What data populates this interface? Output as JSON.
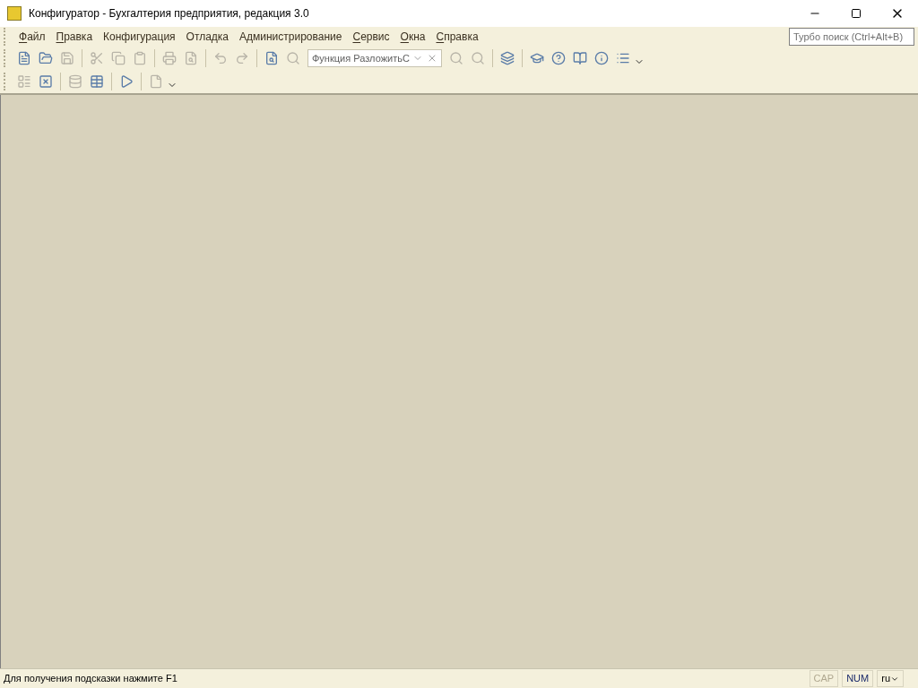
{
  "window": {
    "title": "Конфигуратор - Бухгалтерия предприятия, редакция 3.0"
  },
  "menu": [
    {
      "label": "Файл",
      "accel": true
    },
    {
      "label": "Правка",
      "accel": true
    },
    {
      "label": "Конфигурация",
      "accel": false
    },
    {
      "label": "Отладка",
      "accel": false
    },
    {
      "label": "Администрирование",
      "accel": false
    },
    {
      "label": "Сервис",
      "accel": true
    },
    {
      "label": "Окна",
      "accel": true
    },
    {
      "label": "Справка",
      "accel": true
    }
  ],
  "turbo_search": {
    "placeholder": "Турбо поиск (Ctrl+Alt+B)"
  },
  "toolbar_1": {
    "left_buttons": [
      {
        "disabled": false
      },
      {
        "disabled": false
      },
      {
        "disabled": true
      },
      {
        "disabled": true
      },
      {
        "disabled": true
      },
      {
        "disabled": true
      },
      {
        "disabled": true
      },
      {
        "disabled": true
      },
      {
        "disabled": true
      },
      {
        "disabled": true
      },
      {
        "disabled": false
      },
      {
        "disabled": true
      }
    ],
    "search_field": {
      "value": "Функция РазложитьС"
    },
    "right_buttons": [
      {
        "disabled": true
      },
      {
        "disabled": true
      },
      {
        "disabled": false
      },
      {
        "disabled": false
      },
      {
        "disabled": false
      },
      {
        "disabled": false
      },
      {
        "disabled": false
      },
      {
        "disabled": false
      }
    ]
  },
  "toolbar_2": {
    "buttons": [
      {
        "disabled": true
      },
      {
        "disabled": false
      },
      {
        "disabled": true
      },
      {
        "disabled": false
      },
      {
        "disabled": false
      },
      {
        "disabled": true
      }
    ]
  },
  "status_bar": {
    "hint": "Для получения подсказки нажмите F1",
    "indicators": [
      {
        "label": "CAP",
        "on": false
      },
      {
        "label": "NUM",
        "on": true
      }
    ],
    "language": "ru"
  }
}
